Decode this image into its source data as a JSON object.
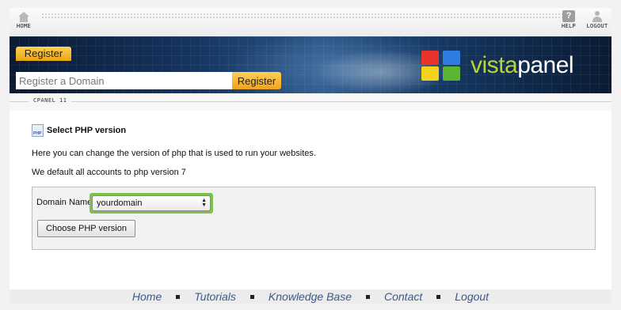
{
  "topbar": {
    "home_label": "HOME",
    "help_label": "HELP",
    "help_glyph": "?",
    "logout_label": "LOGOUT"
  },
  "banner": {
    "register_tag": "Register",
    "register_input_placeholder": "Register a Domain",
    "register_button": "Register",
    "logo": {
      "part1": "vista",
      "part2": "panel"
    },
    "logo_colors": [
      "#e8322b",
      "#2f7de0",
      "#f2d21b",
      "#5ab533"
    ]
  },
  "section_label": "CPANEL 11",
  "content": {
    "icon_text": "PHP",
    "title": "Select PHP version",
    "line1": "Here you can change the version of php that is used to run your websites.",
    "line2": "We default all accounts to php version 7",
    "form": {
      "domain_label": "Domain Name",
      "domain_selected": "yourdomain",
      "choose_button": "Choose PHP version"
    }
  },
  "footer": {
    "links": [
      "Home",
      "Tutorials",
      "Knowledge Base",
      "Contact",
      "Logout"
    ]
  },
  "colors": {
    "accent_yellow": "#f0a41a",
    "select_focus": "#7fc24a",
    "footer_link": "#3b5a8a"
  }
}
